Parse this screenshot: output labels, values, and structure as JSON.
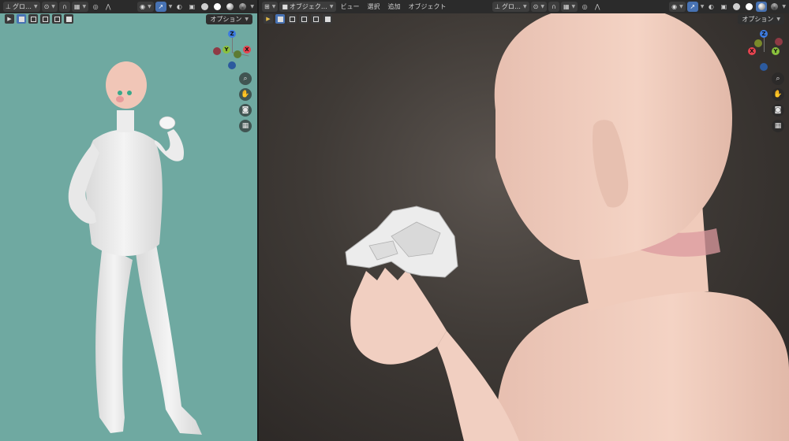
{
  "left_viewport": {
    "header": {
      "orientation_label": "グロ…",
      "options_label": "オプション"
    },
    "gizmo": {
      "z": "Z",
      "y": "Y",
      "x": "X"
    },
    "background_color": "#6fa9a1"
  },
  "right_viewport": {
    "header": {
      "mode_label": "オブジェク…",
      "menu_view": "ビュー",
      "menu_select": "選択",
      "menu_add": "追加",
      "menu_object": "オブジェクト",
      "orientation_label": "グロ…",
      "options_label": "オプション"
    },
    "gizmo": {
      "z": "Z",
      "y": "Y",
      "x": "X"
    }
  },
  "colors": {
    "header_bg": "#2b2b2b",
    "active_blue": "#4772b3",
    "axis_x": "#e8434f",
    "axis_y": "#8ac13d",
    "axis_z": "#3d7be0",
    "skin": "#f2cbb8",
    "body_white": "#eeeeee"
  },
  "icons": {
    "zoom": "magnifier-icon",
    "pan": "hand-icon",
    "camera": "camera-icon",
    "ortho": "grid-icon"
  }
}
